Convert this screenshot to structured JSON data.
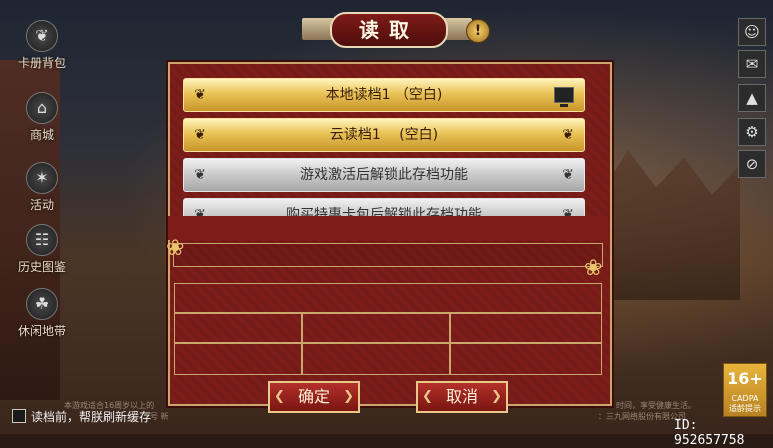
{
  "title": "读取",
  "left_menu": [
    {
      "label": "卡册背包",
      "icon": "bag-icon",
      "glyph": "❦"
    },
    {
      "label": "商城",
      "icon": "shop-icon",
      "glyph": "⌂"
    },
    {
      "label": "活动",
      "icon": "activity-icon",
      "glyph": "✶"
    },
    {
      "label": "历史图鉴",
      "icon": "book-icon",
      "glyph": "☷"
    },
    {
      "label": "休闲地带",
      "icon": "leisure-icon",
      "glyph": "☘"
    }
  ],
  "right_icons": [
    {
      "name": "profile-icon",
      "glyph": "☺"
    },
    {
      "name": "mail-icon",
      "glyph": "✉"
    },
    {
      "name": "bell-icon",
      "glyph": "▲"
    },
    {
      "name": "settings-icon",
      "glyph": "⚙"
    },
    {
      "name": "hide-icon",
      "glyph": "⊘"
    }
  ],
  "slots": [
    {
      "label": "本地读档1 （空白)",
      "style": "gold",
      "device_icon": "computer-icon"
    },
    {
      "label": "云读档1 　(空白)",
      "style": "gold"
    },
    {
      "label": "游戏激活后解锁此存档功能",
      "style": "gray"
    },
    {
      "label": "购买特惠卡包后解锁此存档功能",
      "style": "gray"
    }
  ],
  "buttons": {
    "confirm": "确定",
    "cancel": "取消"
  },
  "footnote": {
    "left": "本游戏适合16周岁以上的",
    "left2": "号 新",
    "right": "时间，享受健康生活。",
    "right2": "：三九网络股份有限公司"
  },
  "checkbox_label": "读档前，帮朕刷新缓存",
  "checkbox_checked": false,
  "age_badge": {
    "rating": "16+",
    "sub_top": "CADPA",
    "sub": "适龄提示"
  },
  "user_id": "ID: 952657758",
  "colors": {
    "panel": "#7c1d1a",
    "gold": "#e9c357",
    "border": "#c9a66b"
  }
}
